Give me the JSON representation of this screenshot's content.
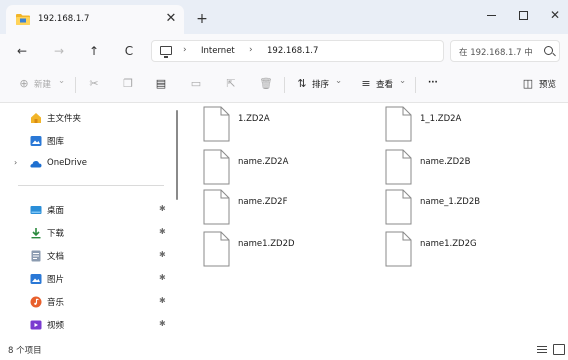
{
  "tab": {
    "title": "192.168.1.7",
    "close": "✕",
    "new": "+"
  },
  "window": {
    "minimize": "",
    "maximize": "",
    "close": "✕"
  },
  "nav": {
    "back": "←",
    "forward": "→",
    "up": "↑",
    "refresh": "C"
  },
  "address": {
    "crumbs": [
      "Internet",
      "192.168.1.7"
    ],
    "separator": "›",
    "leading_separator": "›"
  },
  "search": {
    "placeholder": "在 192.168.1.7 中"
  },
  "toolbar": {
    "new_label": "新建",
    "new_caret": "⌄",
    "sort_label": "排序",
    "sort_caret": "⌄",
    "view_label": "查看",
    "view_caret": "⌄",
    "more_label": "···",
    "preview_label": "预览"
  },
  "sidebar": {
    "items": [
      {
        "label": "主文件夹",
        "icon": "home-icon",
        "color": "#e8a320"
      },
      {
        "label": "图库",
        "icon": "gallery-icon",
        "color": "#2a78d6"
      },
      {
        "label": "OneDrive",
        "icon": "onedrive-icon",
        "color": "#1e6fd0",
        "expand": "›"
      },
      {
        "label": "桌面",
        "icon": "desktop-icon",
        "color": "#2a8ed8",
        "pinned": true
      },
      {
        "label": "下载",
        "icon": "download-icon",
        "color": "#2b8a3e",
        "pinned": true
      },
      {
        "label": "文档",
        "icon": "documents-icon",
        "color": "#6b7f99",
        "pinned": true
      },
      {
        "label": "图片",
        "icon": "pictures-icon",
        "color": "#2a78d6",
        "pinned": true
      },
      {
        "label": "音乐",
        "icon": "music-icon",
        "color": "#e8602c",
        "pinned": true
      },
      {
        "label": "视频",
        "icon": "videos-icon",
        "color": "#7a3bd0",
        "pinned": true
      }
    ],
    "pin_glyph": "✱"
  },
  "files": [
    {
      "name": "1.ZD2A"
    },
    {
      "name": "1_1.ZD2A"
    },
    {
      "name": "name.ZD2A"
    },
    {
      "name": "name.ZD2B"
    },
    {
      "name": "name.ZD2F"
    },
    {
      "name": "name_1.ZD2B"
    },
    {
      "name": "name1.ZD2D"
    },
    {
      "name": "name1.ZD2G"
    }
  ],
  "status": {
    "count_text": "8 个项目"
  }
}
